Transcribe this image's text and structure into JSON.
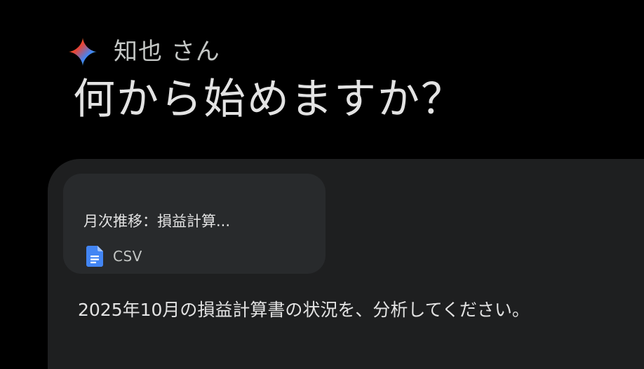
{
  "greeting": {
    "icon": "gemini-spark-icon",
    "name": "知也 さん"
  },
  "headline": "何から始めますか？",
  "composer": {
    "attachment": {
      "title": "月次推移：損益計算...",
      "type_icon": "google-docs-icon",
      "type_label": "CSV"
    },
    "prompt_text": "2025年10月の損益計算書の状況を、分析してください。"
  },
  "colors": {
    "background": "#000000",
    "composer_background": "#1e1f20",
    "card_background": "#282a2c",
    "doc_icon_blue": "#4285f4"
  }
}
